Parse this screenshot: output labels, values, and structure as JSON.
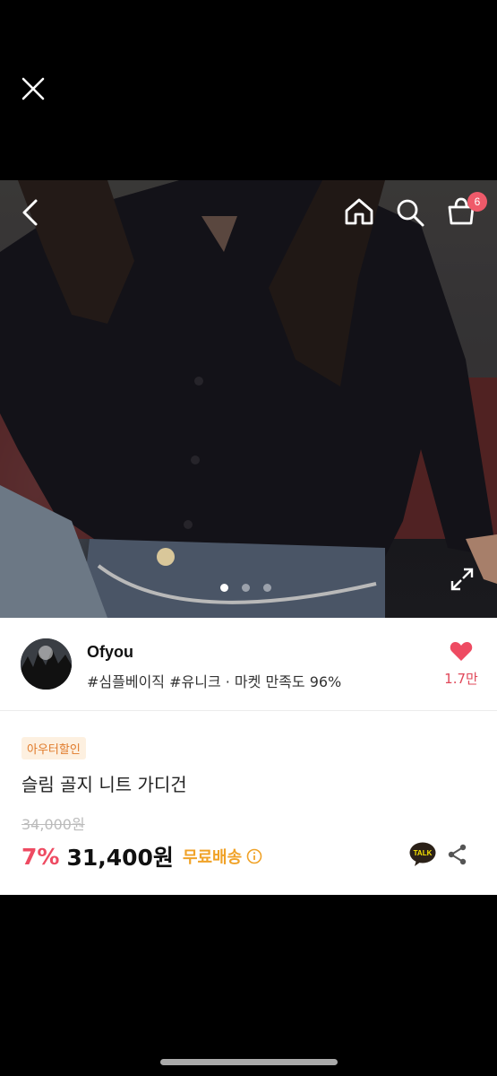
{
  "icons": {
    "close": "close-icon",
    "back": "back-arrow-icon",
    "home": "home-icon",
    "search": "search-icon",
    "cart": "cart-icon",
    "expand": "expand-icon",
    "heart": "heart-icon",
    "info": "info-icon",
    "talk": "kakao-talk-icon",
    "share": "share-icon"
  },
  "header": {
    "cart_count": "6"
  },
  "carousel": {
    "page_count": 3,
    "active_index": 0
  },
  "store": {
    "name": "Ofyou",
    "tags": "#심플베이직 #유니크 · 마켓 만족도 96%",
    "like_count": "1.7만"
  },
  "product": {
    "badge": "아우터할인",
    "title": "슬림 골지 니트 가디건",
    "original_price": "34,000원",
    "discount": "7%",
    "price": "31,400원",
    "shipping": "무료배송",
    "talk_label": "TALK"
  },
  "colors": {
    "accent": "#ee4b62",
    "shipping": "#f0a227",
    "badge_bg": "#fdf0e0",
    "badge_text": "#e07a2a"
  }
}
